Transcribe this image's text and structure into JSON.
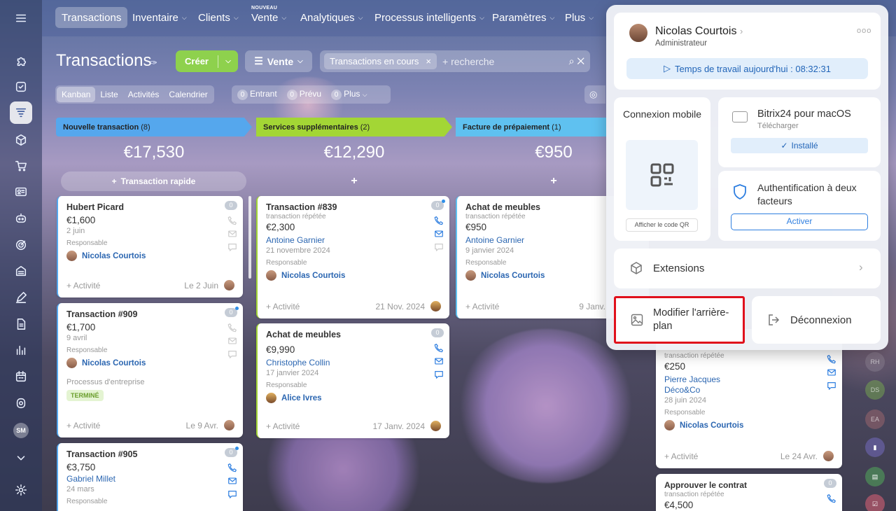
{
  "nav": {
    "items": [
      {
        "label": "Transactions",
        "dropdown": false
      },
      {
        "label": "Inventaire",
        "dropdown": true
      },
      {
        "label": "Clients",
        "dropdown": true
      },
      {
        "label": "Vente",
        "dropdown": true
      },
      {
        "label": "Analytiques",
        "dropdown": true
      },
      {
        "label": "Processus intelligents",
        "dropdown": true
      },
      {
        "label": "Paramètres",
        "dropdown": true
      },
      {
        "label": "Plus",
        "dropdown": true
      }
    ],
    "new_badge": "NOUVEAU"
  },
  "sidebar": {
    "icons": [
      "menu-icon",
      "puzzle-icon",
      "checkbox-icon",
      "funnel-icon",
      "cube-icon",
      "cart-icon",
      "contact-card-icon",
      "robot-icon",
      "target-icon",
      "building-icon",
      "pen-icon",
      "document-icon",
      "bar-chart-icon",
      "calendar-icon",
      "copilot-icon"
    ],
    "user_initials": "SM"
  },
  "page": {
    "title": "Transactions",
    "create_label": "Créer",
    "funnel_label": "Vente",
    "filter_chip": "Transactions en cours",
    "search_placeholder": "+ recherche"
  },
  "views": [
    "Kanban",
    "Liste",
    "Activités",
    "Calendrier"
  ],
  "counters": [
    {
      "count": "0",
      "label": "Entrant"
    },
    {
      "count": "0",
      "label": "Prévu"
    },
    {
      "count": "0",
      "label": "Plus"
    }
  ],
  "columns": [
    {
      "name": "Nouvelle transaction",
      "count": "(8)",
      "color": "#55a7ed",
      "total": "€17,530",
      "quick": "Transaction rapide"
    },
    {
      "name": "Services supplémentaires",
      "count": "(2)",
      "color": "#a3d635",
      "total": "€12,290",
      "quick": ""
    },
    {
      "name": "Facture de prépaiement",
      "count": "(1)",
      "color": "#5fc1f0",
      "total": "€950",
      "quick": ""
    }
  ],
  "cards": {
    "c1": {
      "name": "Hubert Picard",
      "badge": "0",
      "amount": "€1,600",
      "date": "2 juin",
      "resp_label": "Responsable",
      "owner": "Nicolas Courtois",
      "activity": "+ Activité",
      "foot_date": "Le 2 Juin"
    },
    "c2": {
      "name": "Transaction #909",
      "badge": "0",
      "amount": "€1,700",
      "date": "9 avril",
      "resp_label": "Responsable",
      "owner": "Nicolas Courtois",
      "process": "Processus d'entreprise",
      "status": "TERMINÉ",
      "activity": "+ Activité",
      "foot_date": "Le 9 Avr."
    },
    "c3": {
      "name": "Transaction #905",
      "badge": "0",
      "amount": "€3,750",
      "contact": "Gabriel Millet",
      "date": "24 mars",
      "resp_label": "Responsable"
    },
    "c4": {
      "name": "Transaction #839",
      "badge": "0",
      "sub": "transaction répétée",
      "amount": "€2,300",
      "contact": "Antoine Garnier",
      "date": "21 novembre 2024",
      "resp_label": "Responsable",
      "owner": "Nicolas Courtois",
      "activity": "+ Activité",
      "foot_date": "21 Nov. 2024"
    },
    "c5": {
      "name": "Achat de meubles",
      "badge": "0",
      "amount": "€9,990",
      "contact": "Christophe Collin",
      "date": "17 janvier 2024",
      "resp_label": "Responsable",
      "owner": "Alice Ivres",
      "activity": "+ Activité",
      "foot_date": "17 Janv. 2024"
    },
    "c6": {
      "name": "Achat de meubles",
      "sub": "transaction répétée",
      "amount": "€950",
      "contact": "Antoine Garnier",
      "date": "9 janvier 2024",
      "resp_label": "Responsable",
      "owner": "Nicolas Courtois",
      "activity": "+ Activité",
      "foot_date": "9 Janv."
    },
    "c7": {
      "badge": "0",
      "sub": "transaction répétée",
      "amount": "€250",
      "contact": "Pierre Jacques",
      "company": "Déco&Co",
      "date": "28 juin 2024",
      "resp_label": "Responsable",
      "owner": "Nicolas Courtois",
      "activity": "+ Activité",
      "foot_date": "Le 24 Avr."
    },
    "c8": {
      "name": "Approuver le contrat",
      "badge": "0",
      "sub": "transaction répétée",
      "amount": "€4,500"
    }
  },
  "popup": {
    "user_name": "Nicolas Courtois",
    "user_role": "Administrateur",
    "work_time": "Temps de travail aujourd'hui : 08:32:31",
    "mobile_title": "Connexion mobile",
    "qr_button": "Afficher le code QR",
    "desktop_title": "Bitrix24 pour macOS",
    "desktop_sub": "Télécharger",
    "desktop_status": "Installé",
    "twofa_title": "Authentification à deux facteurs",
    "twofa_button": "Activer",
    "extensions": "Extensions",
    "change_bg": "Modifier l'arrière-plan",
    "logout": "Déconnexion"
  },
  "rail": [
    "RH",
    "DS",
    "EA"
  ],
  "accent": "#2f7fe0",
  "highlight_color": "#e0101c"
}
